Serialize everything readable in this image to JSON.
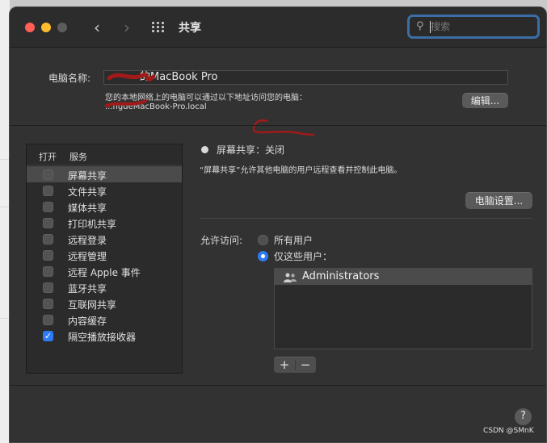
{
  "window": {
    "title": "共享"
  },
  "search": {
    "placeholder": "搜索"
  },
  "computer_name": {
    "label": "电脑名称:",
    "value": "的MacBook Pro",
    "address_desc": "您的本地网络上的电脑可以通过以下地址访问您的电脑：",
    "address": "...ngdeMacBook-Pro.local",
    "edit_button": "编辑..."
  },
  "services": {
    "header_on": "打开",
    "header_service": "服务",
    "items": [
      {
        "label": "屏幕共享",
        "checked": false,
        "selected": true
      },
      {
        "label": "文件共享",
        "checked": false
      },
      {
        "label": "媒体共享",
        "checked": false
      },
      {
        "label": "打印机共享",
        "checked": false
      },
      {
        "label": "远程登录",
        "checked": false
      },
      {
        "label": "远程管理",
        "checked": false
      },
      {
        "label": "远程 Apple 事件",
        "checked": false
      },
      {
        "label": "蓝牙共享",
        "checked": false
      },
      {
        "label": "互联网共享",
        "checked": false
      },
      {
        "label": "内容缓存",
        "checked": false
      },
      {
        "label": "隔空播放接收器",
        "checked": true
      }
    ]
  },
  "detail": {
    "status": "屏幕共享：关闭",
    "description": "“屏幕共享”允许其他电脑的用户远程查看并控制此电脑。",
    "settings_button": "电脑设置...",
    "access_label": "允许访问:",
    "access_options": [
      {
        "label": "所有用户",
        "selected": false
      },
      {
        "label": "仅这些用户：",
        "selected": true
      }
    ],
    "users": [
      "Administrators"
    ],
    "add_button": "+",
    "remove_button": "−"
  },
  "help_button": "?",
  "watermark": "CSDN @SMnK",
  "colors": {
    "accent": "#2f7bf5",
    "annotation": "#a11a1a",
    "window_bg": "#323232"
  }
}
